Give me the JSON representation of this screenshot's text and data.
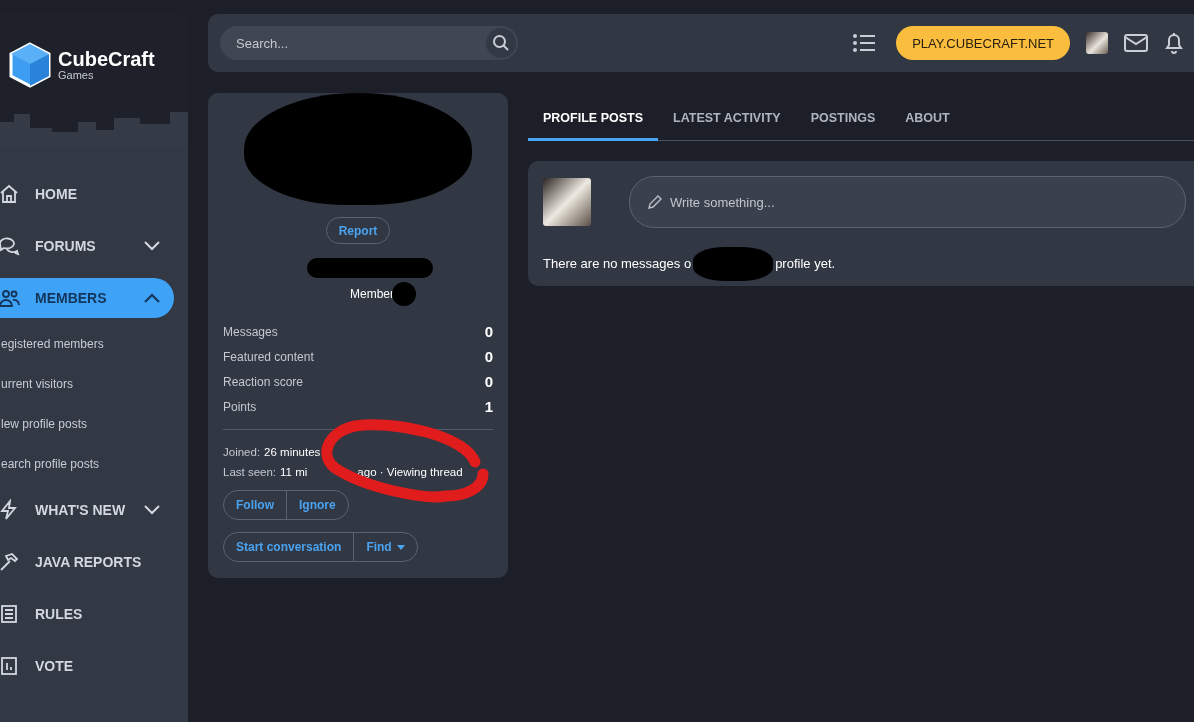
{
  "brand": {
    "name": "CubeCraft",
    "tagline": "Games"
  },
  "sidebar": {
    "items": [
      {
        "label": "HOME",
        "kind": "link",
        "selected": false
      },
      {
        "label": "FORUMS",
        "kind": "group",
        "selected": false,
        "expanded": false
      },
      {
        "label": "MEMBERS",
        "kind": "group",
        "selected": true,
        "expanded": true,
        "children": [
          {
            "label": "egistered members"
          },
          {
            "label": "urrent visitors"
          },
          {
            "label": "lew profile posts"
          },
          {
            "label": "earch profile posts"
          }
        ]
      },
      {
        "label": "WHAT'S NEW",
        "kind": "group",
        "selected": false,
        "expanded": false
      },
      {
        "label": "JAVA REPORTS",
        "kind": "link",
        "selected": false
      },
      {
        "label": "RULES",
        "kind": "link",
        "selected": false
      },
      {
        "label": "VOTE",
        "kind": "link",
        "selected": false
      }
    ]
  },
  "header": {
    "search": {
      "placeholder": "Search..."
    },
    "server_button": "PLAY.CUBECRAFT.NET"
  },
  "profile": {
    "report": "Report",
    "role": "Member",
    "stats": [
      {
        "label": "Messages",
        "value": "0"
      },
      {
        "label": "Featured content",
        "value": "0"
      },
      {
        "label": "Reaction score",
        "value": "0"
      },
      {
        "label": "Points",
        "value": "1"
      }
    ],
    "joined": {
      "label": "Joined:",
      "value": "26 minutes"
    },
    "last_seen": {
      "label": "Last seen:",
      "value_start": "11 mi",
      "value_end": "ago · Viewing thread"
    },
    "button_groups": [
      [
        {
          "label": "Follow",
          "dropdown": false
        },
        {
          "label": "Ignore",
          "dropdown": false
        }
      ],
      [
        {
          "label": "Start conversation",
          "dropdown": false
        },
        {
          "label": "Find",
          "dropdown": true
        }
      ]
    ]
  },
  "tabs": [
    {
      "label": "PROFILE POSTS",
      "selected": true
    },
    {
      "label": "LATEST ACTIVITY",
      "selected": false
    },
    {
      "label": "POSTINGS",
      "selected": false
    },
    {
      "label": "ABOUT",
      "selected": false
    }
  ],
  "composer": {
    "placeholder": "Write something..."
  },
  "empty_message": {
    "start": "There are no messages o",
    "end": "profile yet."
  }
}
